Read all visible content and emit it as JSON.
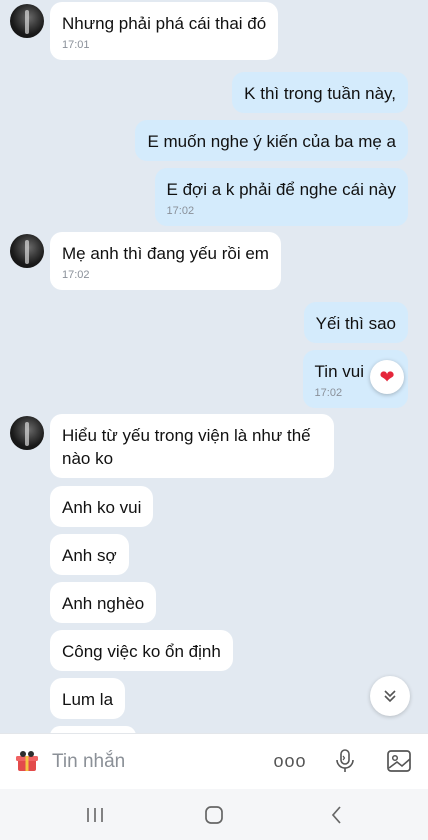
{
  "messages": [
    {
      "text": "Nhưng phải phá cái thai đó",
      "time": "17:01"
    },
    {
      "text": "K thì trong tuần này,"
    },
    {
      "text": "E muốn nghe ý kiến của ba mẹ a"
    },
    {
      "text": "E đợi a k phải để nghe cái này",
      "time": "17:02"
    },
    {
      "text": "Mẹ anh thì đang yếu rồi em",
      "time": "17:02"
    },
    {
      "text": "Yếi thì sao"
    },
    {
      "text": "Tin vui",
      "time": "17:02"
    },
    {
      "text": "Hiểu từ yếu trong viện là như thế nào ko"
    },
    {
      "text": "Anh ko vui"
    },
    {
      "text": "Anh sợ"
    },
    {
      "text": "Anh nghèo"
    },
    {
      "text": "Công việc ko ổn định"
    },
    {
      "text": "Lum la"
    }
  ],
  "reaction": {
    "icon": "heart-icon",
    "color": "#e5263a"
  },
  "composer": {
    "placeholder": "Tin nhắn",
    "more_label": "ooo"
  },
  "colors": {
    "background": "#e2e9f1",
    "incoming": "#ffffff",
    "outgoing": "#d4ebfc",
    "accent": "#1a73e8"
  }
}
